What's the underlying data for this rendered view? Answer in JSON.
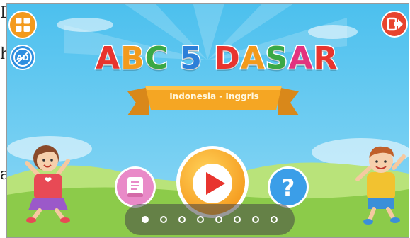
{
  "page_text": {
    "line1": "D",
    "line2": "h",
    "line3": "a"
  },
  "game": {
    "title_letters": [
      {
        "char": "A",
        "color": "#e8342e"
      },
      {
        "char": "B",
        "color": "#f39a1c"
      },
      {
        "char": "C",
        "color": "#3aa845"
      },
      {
        "char": " ",
        "color": "#ffffff"
      },
      {
        "char": "5",
        "color": "#2d7fd8"
      },
      {
        "char": " ",
        "color": "#ffffff"
      },
      {
        "char": "D",
        "color": "#e8342e"
      },
      {
        "char": "A",
        "color": "#f39a1c"
      },
      {
        "char": "S",
        "color": "#3aa845"
      },
      {
        "char": "A",
        "color": "#e2337f"
      },
      {
        "char": "R",
        "color": "#e8342e"
      }
    ],
    "subtitle": "Indonesia - Inggris",
    "ad_badge": "AD"
  },
  "carousel": {
    "count": 8,
    "active_index": 0
  },
  "colors": {
    "sky": "#5cc8f0",
    "ribbon": "#f5a623",
    "play_button": "#f7a625",
    "play_triangle": "#e8342e",
    "book_button": "#e98ac8",
    "help_button": "#3b9ee8",
    "menu_button": "#f39a1c",
    "exit_button": "#e8442e",
    "grass": "#9ed25a"
  }
}
